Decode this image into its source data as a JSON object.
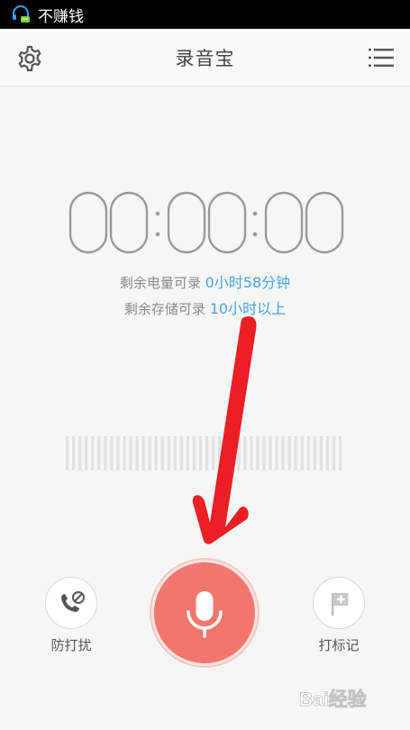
{
  "status_bar": {
    "text": "不赚钱",
    "icon": "headset-chat-icon"
  },
  "app_bar": {
    "title": "录音宝",
    "left_icon": "gear-icon",
    "right_icon": "list-menu-icon"
  },
  "timer": {
    "hours": "00",
    "minutes": "00",
    "seconds": "00",
    "separator": ":"
  },
  "battery_info": {
    "label": "剩余电量可录",
    "value": "0小时58分钟"
  },
  "storage_info": {
    "label": "剩余存储可录",
    "value": "10小时以上"
  },
  "level_meter": {
    "bar_count": 44
  },
  "controls": {
    "do_not_disturb": {
      "label": "防打扰",
      "icon": "phone-block-icon"
    },
    "record": {
      "icon": "microphone-icon"
    },
    "mark": {
      "label": "打标记",
      "icon": "flag-plus-icon"
    }
  },
  "watermark": {
    "text": "Bai经验"
  },
  "colors": {
    "accent": "#4aa3df",
    "record": "#f1766e",
    "arrow": "#ec1f24"
  }
}
